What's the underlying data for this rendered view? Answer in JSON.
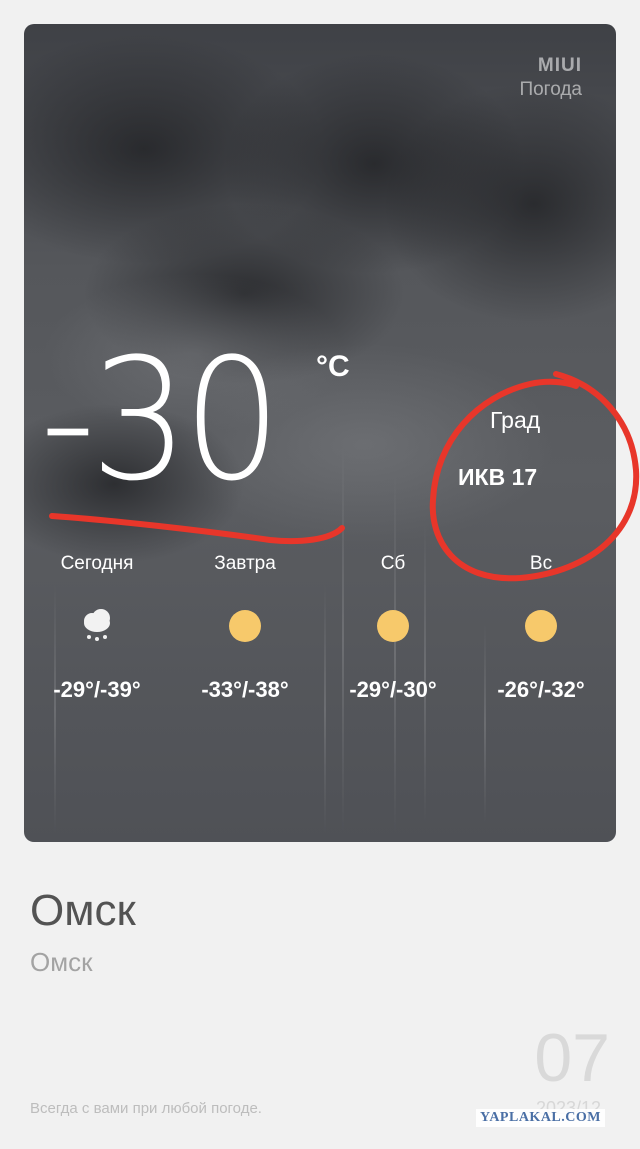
{
  "card": {
    "brand_logo": "MIUI",
    "brand_app": "Погода",
    "temperature": "-30",
    "unit": "°C",
    "condition": "Град",
    "aqi": "ИКВ 17"
  },
  "forecast": [
    {
      "day": "Сегодня",
      "icon": "snow-cloud-icon",
      "range": "-29°/-39°"
    },
    {
      "day": "Завтра",
      "icon": "sun-icon",
      "range": "-33°/-38°"
    },
    {
      "day": "Сб",
      "icon": "sun-icon",
      "range": "-29°/-30°"
    },
    {
      "day": "Вс",
      "icon": "sun-icon",
      "range": "-26°/-32°"
    }
  ],
  "location": {
    "city": "Омск",
    "region": "Омск"
  },
  "footer": {
    "day_number": "07",
    "tagline": "Всегда с вами при любой погоде.",
    "date": "2023/12",
    "watermark": "YAPLAKAL.COM"
  },
  "colors": {
    "annotation_red": "#e8362a",
    "sun": "#f7c96b",
    "card_bg": "#55575b"
  }
}
